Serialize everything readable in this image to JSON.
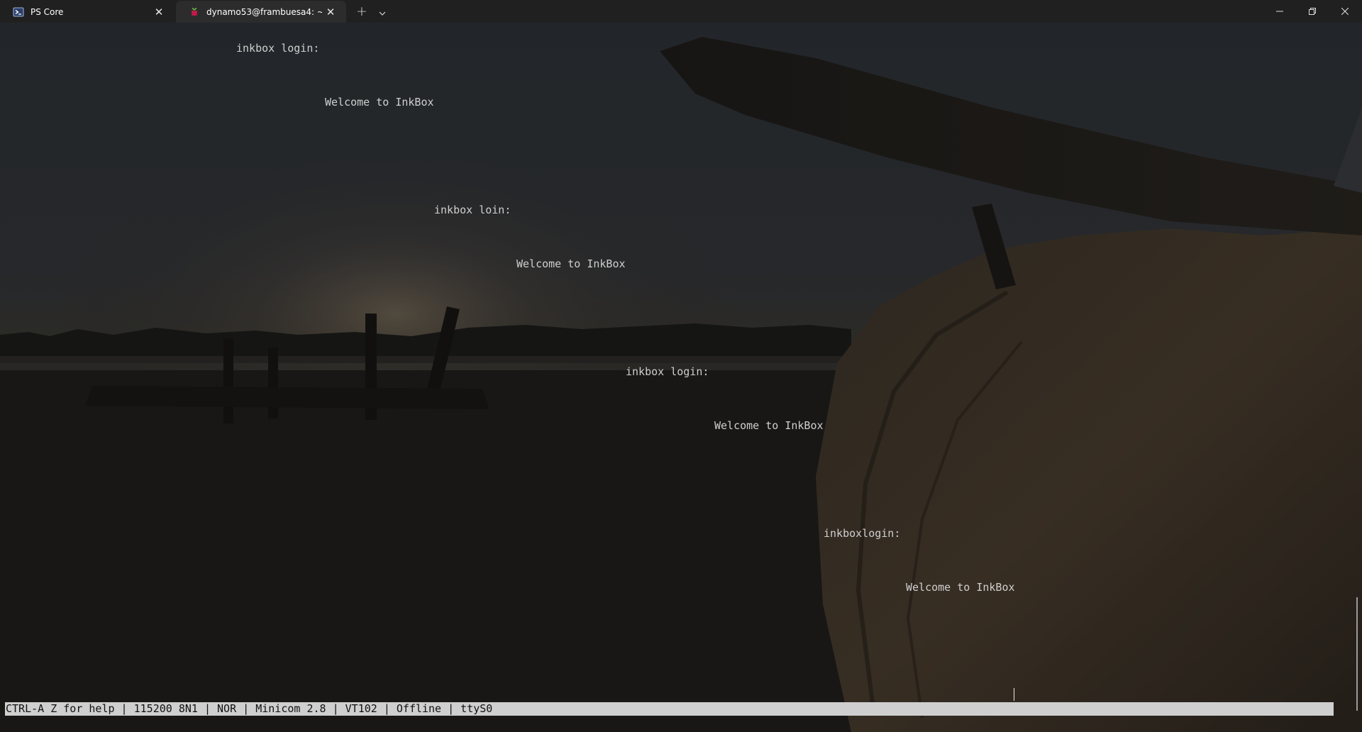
{
  "tabs": [
    {
      "title": "PS Core",
      "icon": "powershell-icon",
      "active": false
    },
    {
      "title": "dynamo53@frambuesa4: ~",
      "icon": "raspberry-pi-icon",
      "active": true
    }
  ],
  "tab_actions": {
    "new_tab_icon": "plus-icon",
    "dropdown_icon": "chevron-down-icon"
  },
  "window_controls": {
    "minimize_icon": "minimize-icon",
    "maximize_icon": "restore-icon",
    "close_icon": "close-icon"
  },
  "terminal": {
    "lines": [
      "inkbox login:",
      "Welcome to InkBox",
      "inkbox loin:",
      "Welcome to InkBox",
      "inkbox login:",
      "Welcome to InkBox",
      "inkboxlogin:",
      "Welcome to InkBox"
    ],
    "status_bar": "CTRL-A Z for help | 115200 8N1 | NOR | Minicom 2.8 | VT102 | Offline | ttyS0"
  },
  "colors": {
    "titlebar": "#202020",
    "active_tab": "#2c2c2c",
    "terminal_text": "#cfcfcf",
    "status_bar_bg": "#cfcfcf"
  }
}
